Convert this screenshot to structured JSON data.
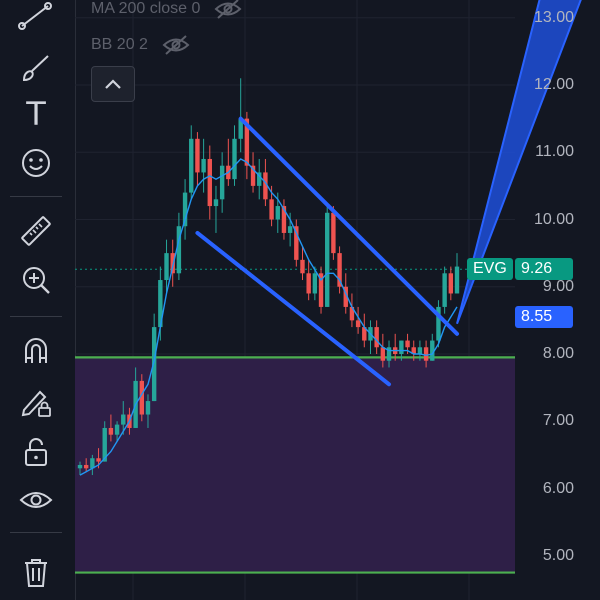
{
  "toolbar": {
    "tools": [
      {
        "name": "trend-line-tool"
      },
      {
        "name": "brush-tool"
      },
      {
        "name": "text-tool",
        "glyph": "T"
      },
      {
        "name": "emoji-tool"
      },
      {
        "name": "measure-tool"
      },
      {
        "name": "zoom-in-tool"
      },
      {
        "name": "magnet-tool"
      },
      {
        "name": "lock-drawing-tool"
      },
      {
        "name": "unlock-tool"
      },
      {
        "name": "visibility-tool"
      },
      {
        "name": "trash-tool"
      }
    ]
  },
  "legend": {
    "ma": "MA 200 close 0",
    "bb": "BB 20 2"
  },
  "price_axis": [
    "13.00",
    "12.00",
    "11.00",
    "10.00",
    "9.00",
    "8.00",
    "7.00",
    "6.00",
    "5.00"
  ],
  "symbol_tag": {
    "name": "EVG",
    "price": "9.26",
    "color": "#089981"
  },
  "crosshair_tag": {
    "price": "8.55",
    "color": "#2962ff"
  },
  "colors": {
    "background": "#131722",
    "up_candle": "#26a69a",
    "down_candle": "#ef5350",
    "channel": "#2962ff",
    "support": "#4caf50",
    "zone": "#2e1f47",
    "ma_line": "#2196f3"
  },
  "chart_data": {
    "type": "candlestick",
    "ylim": [
      4.7,
      13.3
    ],
    "support_levels": [
      7.95,
      4.75
    ],
    "zone": [
      4.75,
      7.95
    ],
    "candles": [
      {
        "o": 6.3,
        "h": 6.4,
        "l": 6.2,
        "c": 6.35
      },
      {
        "o": 6.35,
        "h": 6.45,
        "l": 6.25,
        "c": 6.3
      },
      {
        "o": 6.3,
        "h": 6.5,
        "l": 6.2,
        "c": 6.45
      },
      {
        "o": 6.45,
        "h": 6.6,
        "l": 6.3,
        "c": 6.4
      },
      {
        "o": 6.4,
        "h": 7.0,
        "l": 6.4,
        "c": 6.9
      },
      {
        "o": 6.9,
        "h": 7.1,
        "l": 6.7,
        "c": 6.8
      },
      {
        "o": 6.8,
        "h": 7.0,
        "l": 6.7,
        "c": 6.95
      },
      {
        "o": 6.95,
        "h": 7.3,
        "l": 6.8,
        "c": 7.1
      },
      {
        "o": 7.1,
        "h": 7.2,
        "l": 6.8,
        "c": 6.9
      },
      {
        "o": 6.9,
        "h": 7.8,
        "l": 6.9,
        "c": 7.6
      },
      {
        "o": 7.6,
        "h": 7.7,
        "l": 7.0,
        "c": 7.1
      },
      {
        "o": 7.1,
        "h": 7.4,
        "l": 6.9,
        "c": 7.3
      },
      {
        "o": 7.3,
        "h": 8.6,
        "l": 7.3,
        "c": 8.4
      },
      {
        "o": 8.4,
        "h": 9.3,
        "l": 8.2,
        "c": 9.1
      },
      {
        "o": 9.1,
        "h": 9.7,
        "l": 8.9,
        "c": 9.5
      },
      {
        "o": 9.5,
        "h": 9.7,
        "l": 9.0,
        "c": 9.2
      },
      {
        "o": 9.2,
        "h": 10.1,
        "l": 9.1,
        "c": 9.9
      },
      {
        "o": 9.9,
        "h": 10.6,
        "l": 9.7,
        "c": 10.4
      },
      {
        "o": 10.4,
        "h": 11.4,
        "l": 10.3,
        "c": 11.2
      },
      {
        "o": 11.2,
        "h": 11.3,
        "l": 10.5,
        "c": 10.7
      },
      {
        "o": 10.7,
        "h": 11.2,
        "l": 10.4,
        "c": 10.9
      },
      {
        "o": 10.9,
        "h": 11.1,
        "l": 10.0,
        "c": 10.2
      },
      {
        "o": 10.2,
        "h": 10.5,
        "l": 9.8,
        "c": 10.3
      },
      {
        "o": 10.3,
        "h": 11.0,
        "l": 10.1,
        "c": 10.8
      },
      {
        "o": 10.8,
        "h": 11.2,
        "l": 10.5,
        "c": 10.6
      },
      {
        "o": 10.6,
        "h": 11.4,
        "l": 10.5,
        "c": 11.2
      },
      {
        "o": 11.2,
        "h": 12.1,
        "l": 11.0,
        "c": 11.5
      },
      {
        "o": 11.5,
        "h": 11.6,
        "l": 10.6,
        "c": 10.8
      },
      {
        "o": 10.8,
        "h": 11.0,
        "l": 10.4,
        "c": 10.5
      },
      {
        "o": 10.5,
        "h": 10.9,
        "l": 10.3,
        "c": 10.7
      },
      {
        "o": 10.7,
        "h": 10.9,
        "l": 10.2,
        "c": 10.3
      },
      {
        "o": 10.3,
        "h": 10.5,
        "l": 9.9,
        "c": 10.0
      },
      {
        "o": 10.0,
        "h": 10.4,
        "l": 9.8,
        "c": 10.2
      },
      {
        "o": 10.2,
        "h": 10.3,
        "l": 9.7,
        "c": 9.8
      },
      {
        "o": 9.8,
        "h": 10.1,
        "l": 9.6,
        "c": 9.9
      },
      {
        "o": 9.9,
        "h": 10.0,
        "l": 9.3,
        "c": 9.4
      },
      {
        "o": 9.4,
        "h": 9.6,
        "l": 9.1,
        "c": 9.2
      },
      {
        "o": 9.2,
        "h": 9.4,
        "l": 8.8,
        "c": 8.9
      },
      {
        "o": 8.9,
        "h": 9.3,
        "l": 8.8,
        "c": 9.2
      },
      {
        "o": 9.2,
        "h": 9.3,
        "l": 8.6,
        "c": 8.7
      },
      {
        "o": 8.7,
        "h": 10.2,
        "l": 8.7,
        "c": 10.1
      },
      {
        "o": 10.1,
        "h": 10.2,
        "l": 9.4,
        "c": 9.5
      },
      {
        "o": 9.5,
        "h": 9.6,
        "l": 8.9,
        "c": 9.0
      },
      {
        "o": 9.0,
        "h": 9.2,
        "l": 8.6,
        "c": 8.7
      },
      {
        "o": 8.7,
        "h": 8.9,
        "l": 8.4,
        "c": 8.5
      },
      {
        "o": 8.5,
        "h": 8.7,
        "l": 8.3,
        "c": 8.4
      },
      {
        "o": 8.4,
        "h": 8.6,
        "l": 8.1,
        "c": 8.2
      },
      {
        "o": 8.2,
        "h": 8.5,
        "l": 8.0,
        "c": 8.4
      },
      {
        "o": 8.4,
        "h": 8.5,
        "l": 8.0,
        "c": 8.1
      },
      {
        "o": 8.1,
        "h": 8.3,
        "l": 7.8,
        "c": 7.9
      },
      {
        "o": 7.9,
        "h": 8.2,
        "l": 7.8,
        "c": 8.1
      },
      {
        "o": 8.1,
        "h": 8.3,
        "l": 7.9,
        "c": 8.0
      },
      {
        "o": 8.0,
        "h": 8.2,
        "l": 7.9,
        "c": 8.2
      },
      {
        "o": 8.2,
        "h": 8.3,
        "l": 8.0,
        "c": 8.1
      },
      {
        "o": 8.1,
        "h": 8.2,
        "l": 7.9,
        "c": 8.0
      },
      {
        "o": 8.0,
        "h": 8.2,
        "l": 7.9,
        "c": 8.1
      },
      {
        "o": 8.1,
        "h": 8.2,
        "l": 7.8,
        "c": 7.9
      },
      {
        "o": 7.9,
        "h": 8.3,
        "l": 7.9,
        "c": 8.2
      },
      {
        "o": 8.2,
        "h": 8.8,
        "l": 8.1,
        "c": 8.7
      },
      {
        "o": 8.7,
        "h": 9.3,
        "l": 8.6,
        "c": 9.2
      },
      {
        "o": 9.2,
        "h": 9.3,
        "l": 8.8,
        "c": 8.9
      },
      {
        "o": 8.9,
        "h": 9.5,
        "l": 8.9,
        "c": 9.3
      }
    ],
    "ma_line": [
      6.2,
      6.25,
      6.3,
      6.35,
      6.45,
      6.55,
      6.7,
      6.85,
      7.0,
      7.25,
      7.4,
      7.55,
      7.9,
      8.4,
      8.9,
      9.3,
      9.7,
      10.0,
      10.3,
      10.5,
      10.6,
      10.65,
      10.6,
      10.65,
      10.7,
      10.8,
      10.9,
      10.85,
      10.75,
      10.65,
      10.55,
      10.4,
      10.3,
      10.15,
      10.0,
      9.8,
      9.6,
      9.4,
      9.25,
      9.1,
      9.2,
      9.2,
      9.1,
      8.9,
      8.7,
      8.55,
      8.4,
      8.3,
      8.2,
      8.1,
      8.05,
      8.05,
      8.05,
      8.05,
      8.0,
      8.0,
      7.98,
      8.0,
      8.15,
      8.4,
      8.55,
      8.7
    ],
    "channel": {
      "upper": [
        [
          26,
          11.5
        ],
        [
          61,
          8.3
        ]
      ],
      "lower": [
        [
          19,
          9.8
        ],
        [
          50,
          7.55
        ]
      ]
    },
    "projection": {
      "base": [
        [
          61,
          8.45
        ]
      ],
      "top_left": [
        [
          75,
          13.5
        ]
      ],
      "top_right": [
        [
          82,
          13.5
        ]
      ]
    }
  }
}
